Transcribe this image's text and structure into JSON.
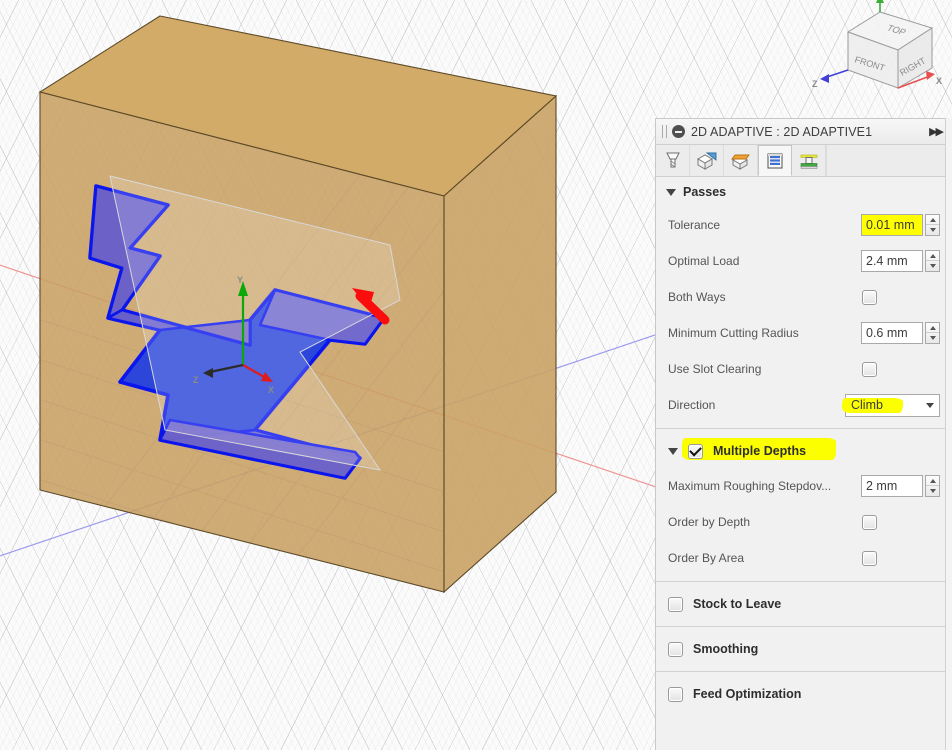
{
  "panel": {
    "title": "2D ADAPTIVE : 2D ADAPTIVE1",
    "collapse_icon": "minus-circle-icon",
    "expand_icon": "double-chevron-right-icon",
    "tabs": [
      {
        "name": "tool",
        "icon": "endmill-tool-icon",
        "selected": false
      },
      {
        "name": "geometry",
        "icon": "blue-cube-geometry-icon",
        "selected": false
      },
      {
        "name": "heights",
        "icon": "orange-cube-heights-icon",
        "selected": false
      },
      {
        "name": "passes",
        "icon": "passes-layers-icon",
        "selected": true
      },
      {
        "name": "linking",
        "icon": "green-linking-icon",
        "selected": false
      }
    ],
    "passes": {
      "header": "Passes",
      "rows": [
        {
          "label": "Tolerance",
          "type": "number",
          "value": "0.01 mm",
          "highlight": true
        },
        {
          "label": "Optimal Load",
          "type": "number",
          "value": "2.4 mm",
          "highlight": false
        },
        {
          "label": "Both Ways",
          "type": "checkbox",
          "checked": false
        },
        {
          "label": "Minimum Cutting Radius",
          "type": "number",
          "value": "0.6 mm",
          "highlight": false
        },
        {
          "label": "Use Slot Clearing",
          "type": "checkbox",
          "checked": false
        },
        {
          "label": "Direction",
          "type": "combo",
          "value": "Climb",
          "highlight": true
        }
      ]
    },
    "multiple_depths": {
      "header": "Multiple Depths",
      "checked": true,
      "highlight": true,
      "rows": [
        {
          "label": "Maximum Roughing Stepdov...",
          "type": "number",
          "value": "2 mm",
          "highlight": false
        },
        {
          "label": "Order by Depth",
          "type": "checkbox",
          "checked": false
        },
        {
          "label": "Order By Area",
          "type": "checkbox",
          "checked": false
        }
      ]
    },
    "collapsed_sections": [
      {
        "label": "Stock to Leave",
        "checked": false
      },
      {
        "label": "Smoothing",
        "checked": false
      },
      {
        "label": "Feed Optimization",
        "checked": false
      }
    ]
  },
  "viewport": {
    "viewcube": {
      "faces": {
        "top": "TOP",
        "front": "FRONT",
        "right": "RIGHT"
      }
    },
    "axis_labels": {
      "x": "X",
      "y": "Y",
      "z": "Z"
    },
    "origin_triad": {
      "x_color": "#e01b1b",
      "y_color": "#0aa80a",
      "z_color": "#2b2b2b"
    },
    "annotation": {
      "name": "red-arrow-annotation",
      "color": "#fb0d0d"
    },
    "colors": {
      "stock_top": "#d0a866",
      "stock_front": "#c49a5e",
      "stock_side": "#c9a063",
      "pocket_floor": "#2b46d8",
      "pocket_wall": "#6f63c6",
      "toolpath_outline": "#0b16ee",
      "grid": "#9a9aa0",
      "axis_x_line": "#e88a8a",
      "axis_z_line": "#8a8ae8"
    }
  }
}
